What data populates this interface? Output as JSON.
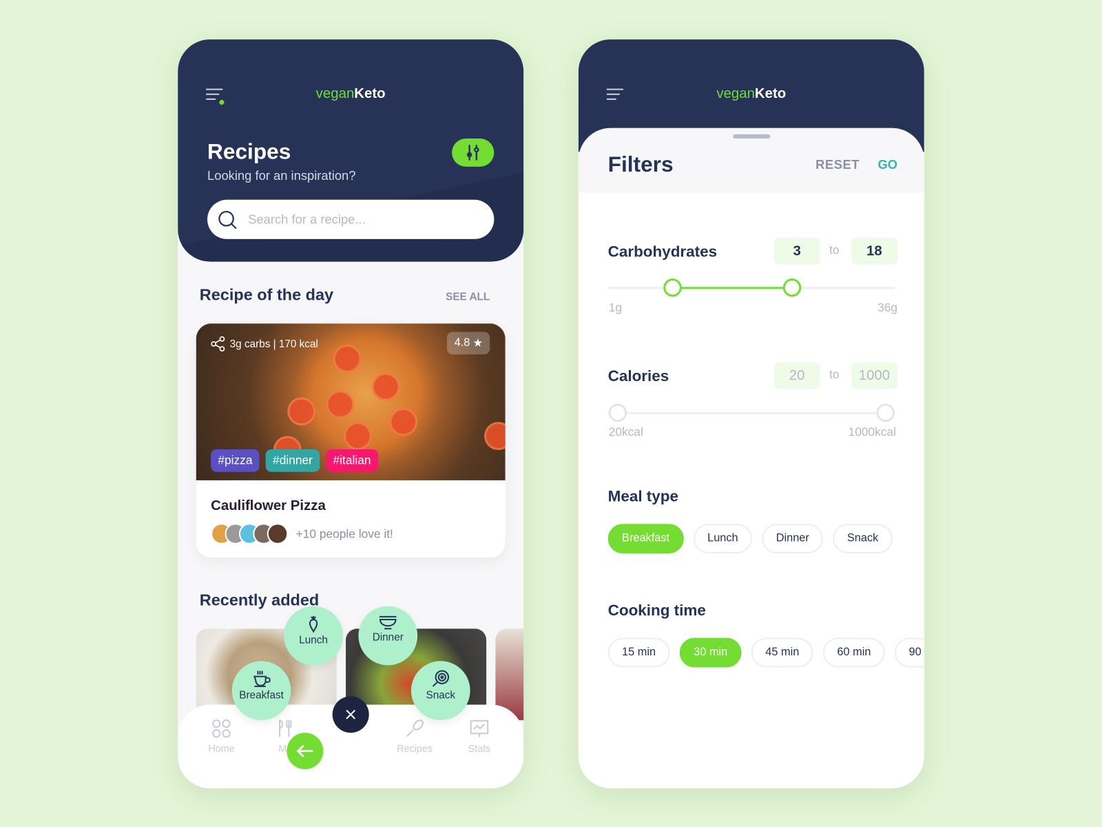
{
  "colors": {
    "background": "#e3f5d6",
    "header": "#263357",
    "accent": "#74dd33",
    "go": "#35b3b0",
    "fab": "#aef0cc"
  },
  "app": {
    "logo_part1": "vegan",
    "logo_part2": "Keto"
  },
  "recipes": {
    "title": "Recipes",
    "subtitle": "Looking for an inspiration?",
    "search_placeholder": "Search for a recipe...",
    "recipe_of_day_label": "Recipe of the day",
    "see_all": "SEE ALL",
    "card": {
      "meta": "3g carbs | 170 kcal",
      "rating": "4.8",
      "tags": [
        {
          "label": "#pizza",
          "color": "#5b4fc4"
        },
        {
          "label": "#dinner",
          "color": "#33a6a4"
        },
        {
          "label": "#italian",
          "color": "#f5186e"
        }
      ],
      "name": "Cauliflower Pizza",
      "love": "+10 people love it!"
    },
    "recently_added": "Recently added",
    "fab_menu": [
      {
        "label": "Lunch",
        "icon": "carrot-icon"
      },
      {
        "label": "Dinner",
        "icon": "bowl-icon"
      },
      {
        "label": "Breakfast",
        "icon": "cup-icon"
      },
      {
        "label": "Snack",
        "icon": "lollipop-icon"
      }
    ],
    "nav": [
      {
        "label": "Home",
        "icon": "grid-icon"
      },
      {
        "label": "Me",
        "icon": "fork-knife-icon"
      },
      {
        "label": "Recipes",
        "icon": "whisk-icon"
      },
      {
        "label": "Stats",
        "icon": "chart-icon"
      }
    ]
  },
  "filters": {
    "title": "Filters",
    "reset": "RESET",
    "go": "GO",
    "carbs": {
      "label": "Carbohydrates",
      "from": "3",
      "to_word": "to",
      "to": "18",
      "min_label": "1g",
      "max_label": "36g",
      "min": 1,
      "max": 36
    },
    "calories": {
      "label": "Calories",
      "from": "20",
      "to_word": "to",
      "to": "1000",
      "min_label": "20kcal",
      "max_label": "1000kcal",
      "min": 20,
      "max": 1000
    },
    "meal_type": {
      "label": "Meal type",
      "options": [
        "Breakfast",
        "Lunch",
        "Dinner",
        "Snack"
      ],
      "selected": "Breakfast"
    },
    "cooking_time": {
      "label": "Cooking time",
      "options": [
        "15 min",
        "30 min",
        "45 min",
        "60 min",
        "90"
      ],
      "selected": "30 min"
    }
  }
}
